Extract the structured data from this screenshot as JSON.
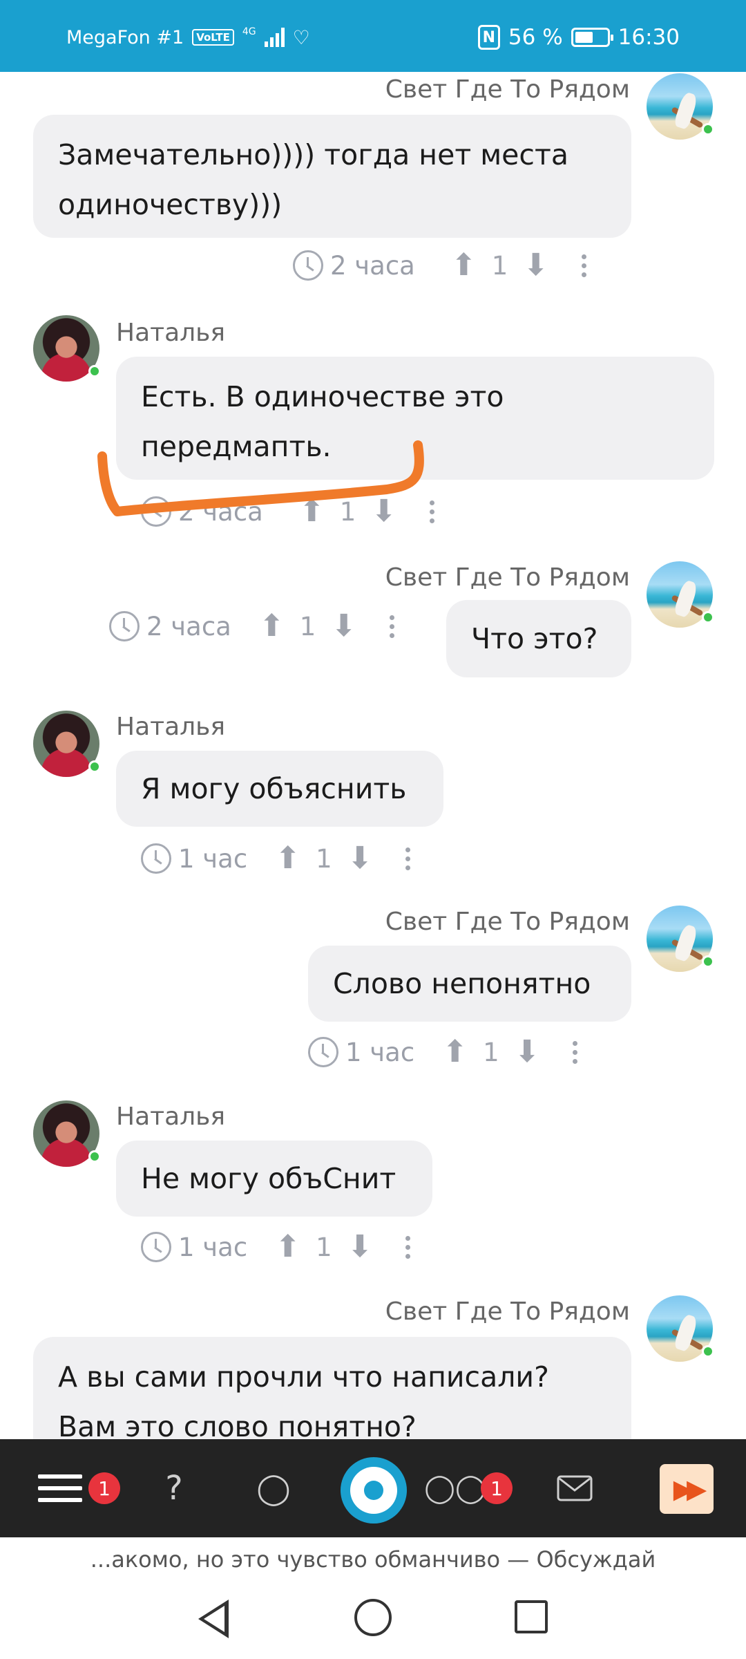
{
  "status_bar": {
    "carrier": "MegaFon #1",
    "volte": "VoLTE",
    "network": "4G",
    "nfc": "N",
    "battery_percent": "56 %",
    "battery_level": 0.56,
    "time": "16:30"
  },
  "messages": [
    {
      "author": "Свет Где То Рядом",
      "side": "right",
      "lines": [
        "Замечательно)))) тогда нет места",
        "одиночеству)))"
      ],
      "time": "2 часа",
      "votes": "1"
    },
    {
      "author": "Наталья",
      "side": "left",
      "lines": [
        "Есть. В одиночестве это",
        "передмапть."
      ],
      "time": "2 часа",
      "votes": "1"
    },
    {
      "author": "Свет Где То Рядом",
      "side": "right",
      "lines": [
        "Что это?"
      ],
      "time": "2 часа",
      "votes": "1"
    },
    {
      "author": "Наталья",
      "side": "left",
      "lines": [
        "Я могу объяснить"
      ],
      "time": "1 час",
      "votes": "1"
    },
    {
      "author": "Свет Где То Рядом",
      "side": "right",
      "lines": [
        "Слово непонятно"
      ],
      "time": "1 час",
      "votes": "1"
    },
    {
      "author": "Наталья",
      "side": "left",
      "lines": [
        "Не могу объСнит"
      ],
      "time": "1 час",
      "votes": "1"
    },
    {
      "author": "Свет Где То Рядом",
      "side": "right",
      "lines": [
        "А вы сами прочли что написали?",
        "Вам это слово понятно?"
      ]
    }
  ],
  "toolbar": {
    "menu_badge": "1",
    "chats_badge": "1"
  },
  "ticker_text": "...акомо, но это чувство обманчиво — Обсуждай",
  "colors": {
    "status_bar": "#1aa0cf",
    "toolbar": "#232323",
    "badge": "#e8343d",
    "annotation": "#f07a2a"
  }
}
